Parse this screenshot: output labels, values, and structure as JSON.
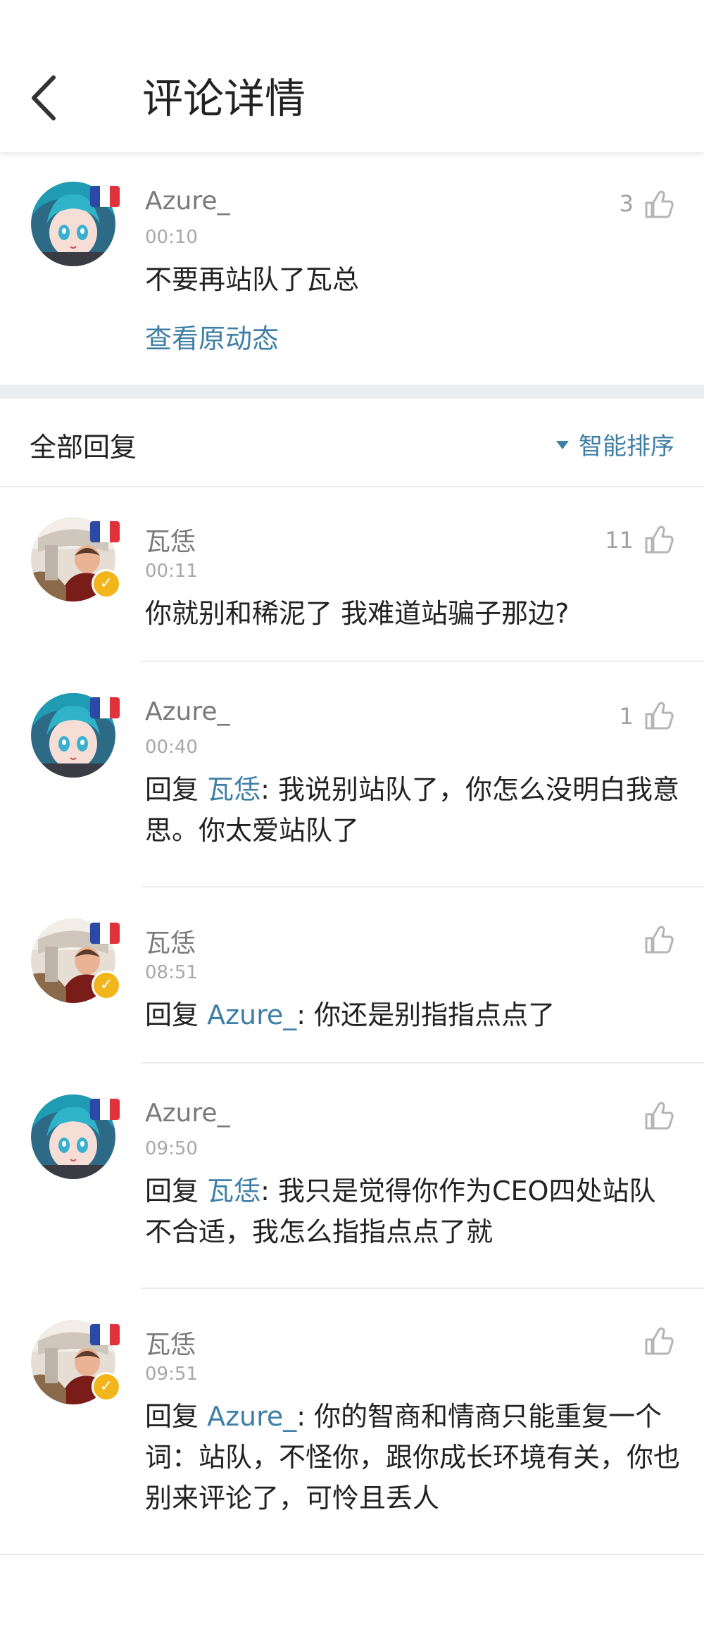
{
  "header": {
    "title": "评论详情"
  },
  "original": {
    "username": "Azure_",
    "time": "00:10",
    "likes": "3",
    "text": "不要再站队了瓦总",
    "view_link": "查看原动态"
  },
  "replies_header": {
    "title": "全部回复",
    "sort_label": "智能排序"
  },
  "replies": [
    {
      "username": "瓦恁",
      "time": "00:11",
      "likes": "11",
      "prefix": "",
      "target": "",
      "text": "你就别和稀泥了 我难道站骗子那边?"
    },
    {
      "username": "Azure_",
      "time": "00:40",
      "likes": "1",
      "prefix": "回复 ",
      "target": "瓦恁",
      "text": ": 我说别站队了，你怎么没明白我意思。你太爱站队了"
    },
    {
      "username": "瓦恁",
      "time": "08:51",
      "likes": "",
      "prefix": "回复 ",
      "target": "Azure_",
      "text": ": 你还是别指指点点了"
    },
    {
      "username": "Azure_",
      "time": "09:50",
      "likes": "",
      "prefix": "回复 ",
      "target": "瓦恁",
      "text": ": 我只是觉得你作为CEO四处站队不合适，我怎么指指点点了就"
    },
    {
      "username": "瓦恁",
      "time": "09:51",
      "likes": "",
      "prefix": "回复 ",
      "target": "Azure_",
      "text": ": 你的智商和情商只能重复一个词：站队，不怪你，跟你成长环境有关，你也别来评论了，可怜且丢人"
    }
  ],
  "colors": {
    "link": "#3f7fa6",
    "section_band": "#eceff2",
    "verified": "#f2b51c"
  },
  "icons": {
    "back": "chevron-left-icon",
    "like": "thumbs-up-icon",
    "sort": "triangle-down-icon",
    "flag": "france-flag-icon",
    "verified": "verified-badge-icon"
  }
}
